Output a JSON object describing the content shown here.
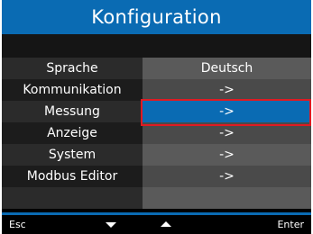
{
  "title": "Konfiguration",
  "menu": [
    {
      "label": "Sprache",
      "value": "Deutsch"
    },
    {
      "label": "Kommunikation",
      "value": "->"
    },
    {
      "label": "Messung",
      "value": "->"
    },
    {
      "label": "Anzeige",
      "value": "->"
    },
    {
      "label": "System",
      "value": "->"
    },
    {
      "label": "Modbus Editor",
      "value": "->"
    }
  ],
  "footer": {
    "esc": "Esc",
    "down_icon": "arrow-down-icon",
    "up_icon": "arrow-up-icon",
    "enter": "Enter"
  },
  "colors": {
    "accent": "#0a6bb3",
    "selection_border": "#e01a22"
  }
}
